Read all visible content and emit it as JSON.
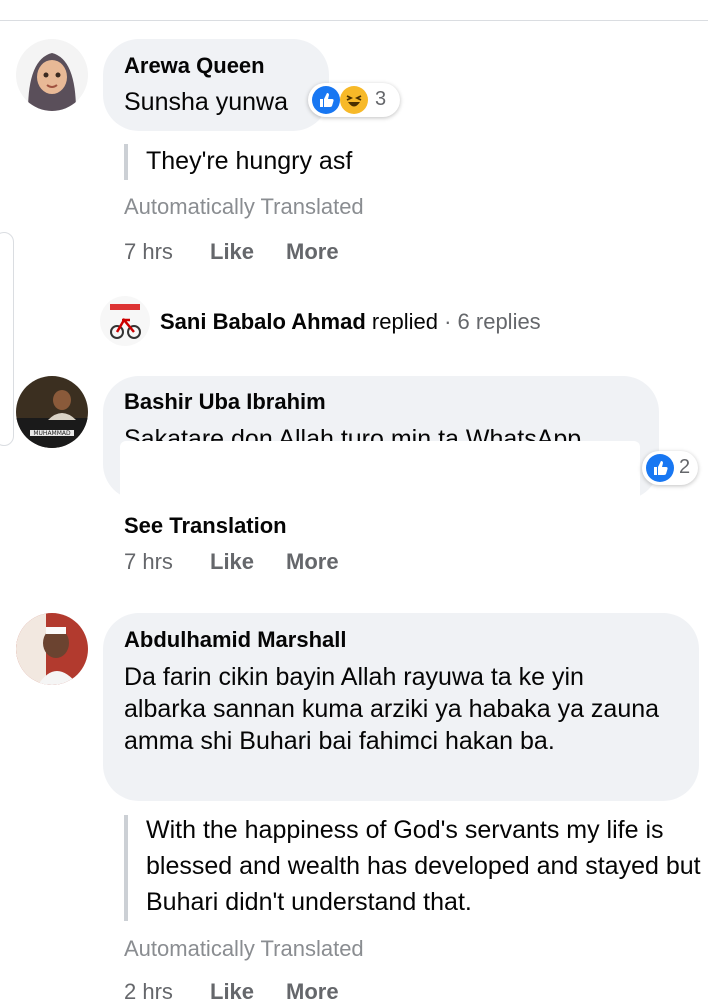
{
  "comments": [
    {
      "author": "Arewa Queen",
      "text": "Sunsha yunwa",
      "reaction_count": "3",
      "translation": "They're hungry asf",
      "auto_label": "Automatically Translated",
      "time": "7 hrs",
      "like": "Like",
      "more": "More"
    },
    {
      "author": "Bashir Uba Ibrahim",
      "text": "Sakatare don Allah turo min ta WhatsApp",
      "reaction_count": "2",
      "see_translation": "See Translation",
      "time": "7 hrs",
      "like": "Like",
      "more": "More",
      "avatar_caption": "MUHAMMAD"
    },
    {
      "author": "Abdulhamid Marshall",
      "text": "Da farin cikin bayin Allah rayuwa ta ke yin albarka sannan kuma arziki ya habaka ya zauna amma shi Buhari bai fahimci hakan ba.",
      "translation": "With the happiness of God's servants my life is blessed and wealth has developed and stayed but Buhari didn't understand that.",
      "auto_label": "Automatically Translated",
      "time": "2 hrs",
      "like": "Like",
      "more": "More"
    }
  ],
  "replies_summary": {
    "author": "Sani Babalo Ahmad",
    "verb": "replied",
    "separator": "·",
    "count": "6 replies"
  },
  "colors": {
    "bubble": "#f0f2f5",
    "secondary_text": "#65676b",
    "muted_text": "#8a8d91",
    "like_blue": "#1877f2",
    "haha_yellow": "#f7b928"
  },
  "icons": [
    "like-reaction-icon",
    "haha-reaction-icon"
  ]
}
